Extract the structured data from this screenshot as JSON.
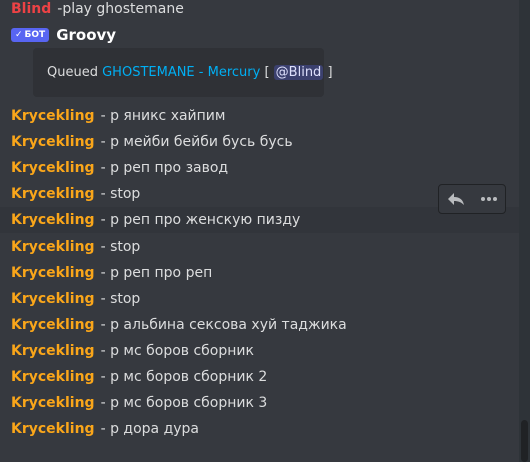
{
  "colors": {
    "background": "#36393f",
    "krycekling": "#faa61a",
    "blind": "#ed4245",
    "link": "#00aff4"
  },
  "top_message": {
    "author": "Blind",
    "content": "-play ghostemane"
  },
  "bot": {
    "tag": "БОТ",
    "name": "Groovy"
  },
  "embed": {
    "prefix": "Queued",
    "link": "GHOSTEMANE - Mercury",
    "open": "[",
    "mention": "@Blind",
    "close": "]"
  },
  "toolbar": {
    "reply_icon": "reply-icon",
    "more_icon": "more-icon"
  },
  "messages": [
    {
      "author": "Krycekling",
      "content": "- р яникс хайпим"
    },
    {
      "author": "Krycekling",
      "content": "- р мейби бейби бусь бусь"
    },
    {
      "author": "Krycekling",
      "content": "- р реп про завод"
    },
    {
      "author": "Krycekling",
      "content": "- stop"
    },
    {
      "author": "Krycekling",
      "content": "- р реп про женскую пизду"
    },
    {
      "author": "Krycekling",
      "content": "- stop"
    },
    {
      "author": "Krycekling",
      "content": "- р реп про реп"
    },
    {
      "author": "Krycekling",
      "content": "- stop"
    },
    {
      "author": "Krycekling",
      "content": "- р альбина сексова хуй таджика"
    },
    {
      "author": "Krycekling",
      "content": "- р мс боров сборник"
    },
    {
      "author": "Krycekling",
      "content": "- р мс боров сборник 2"
    },
    {
      "author": "Krycekling",
      "content": "- р мс боров сборник 3"
    },
    {
      "author": "Krycekling",
      "content": "- р дора дура"
    }
  ]
}
